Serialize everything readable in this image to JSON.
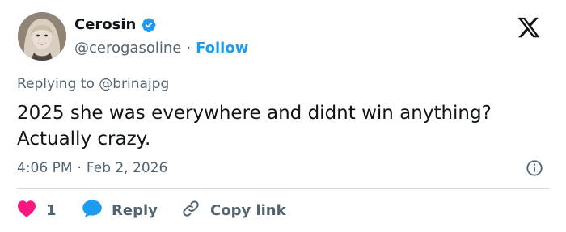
{
  "user": {
    "display_name": "Cerosin",
    "handle": "@cerogasoline",
    "separator": "·",
    "follow_label": "Follow"
  },
  "tweet": {
    "reply_prefix": "Replying to",
    "reply_handle": "@brinajpg",
    "text": "2025 she was everywhere and didnt win anything?\nActually crazy.",
    "time": "4:06 PM",
    "meta_separator": "·",
    "date": "Feb 2, 2026"
  },
  "actions": {
    "like_count": "1",
    "reply_label": "Reply",
    "copy_label": "Copy link"
  },
  "colors": {
    "accent": "#1d9bf0",
    "like": "#f91880",
    "muted_text": "#536471",
    "text": "#0f1419",
    "divider": "#cfd9de"
  },
  "icons": [
    "verified-badge-icon",
    "x-logo-icon",
    "info-icon",
    "heart-icon",
    "reply-bubble-icon",
    "link-icon"
  ]
}
